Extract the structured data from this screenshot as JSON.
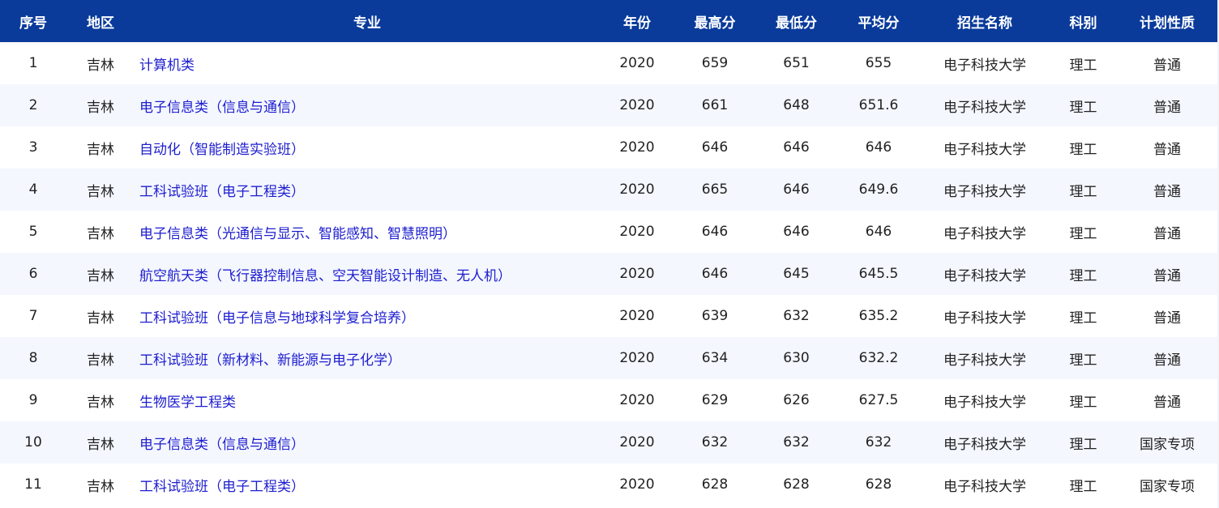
{
  "headers": [
    "序号",
    "地区",
    "专业",
    "年份",
    "最高分",
    "最低分",
    "平均分",
    "招生名称",
    "科别",
    "计划性质"
  ],
  "rows": [
    [
      "1",
      "吉林",
      "计算机类",
      "2020",
      "659",
      "651",
      "655",
      "电子科技大学",
      "理工",
      "普通"
    ],
    [
      "2",
      "吉林",
      "电子信息类（信息与通信）",
      "2020",
      "661",
      "648",
      "651.6",
      "电子科技大学",
      "理工",
      "普通"
    ],
    [
      "3",
      "吉林",
      "自动化（智能制造实验班）",
      "2020",
      "646",
      "646",
      "646",
      "电子科技大学",
      "理工",
      "普通"
    ],
    [
      "4",
      "吉林",
      "工科试验班（电子工程类）",
      "2020",
      "665",
      "646",
      "649.6",
      "电子科技大学",
      "理工",
      "普通"
    ],
    [
      "5",
      "吉林",
      "电子信息类（光通信与显示、智能感知、智慧照明）",
      "2020",
      "646",
      "646",
      "646",
      "电子科技大学",
      "理工",
      "普通"
    ],
    [
      "6",
      "吉林",
      "航空航天类（飞行器控制信息、空天智能设计制造、无人机）",
      "2020",
      "646",
      "645",
      "645.5",
      "电子科技大学",
      "理工",
      "普通"
    ],
    [
      "7",
      "吉林",
      "工科试验班（电子信息与地球科学复合培养）",
      "2020",
      "639",
      "632",
      "635.2",
      "电子科技大学",
      "理工",
      "普通"
    ],
    [
      "8",
      "吉林",
      "工科试验班（新材料、新能源与电子化学）",
      "2020",
      "634",
      "630",
      "632.2",
      "电子科技大学",
      "理工",
      "普通"
    ],
    [
      "9",
      "吉林",
      "生物医学工程类",
      "2020",
      "629",
      "626",
      "627.5",
      "电子科技大学",
      "理工",
      "普通"
    ],
    [
      "10",
      "吉林",
      "电子信息类（信息与通信）",
      "2020",
      "632",
      "632",
      "632",
      "电子科技大学",
      "理工",
      "国家专项"
    ],
    [
      "11",
      "吉林",
      "工科试验班（电子工程类）",
      "2020",
      "628",
      "628",
      "628",
      "电子科技大学",
      "理工",
      "国家专项"
    ]
  ],
  "colors": {
    "header_bg": "#0a3b9b",
    "link": "#1d1dcf",
    "stripe": "#f4f7fe"
  }
}
